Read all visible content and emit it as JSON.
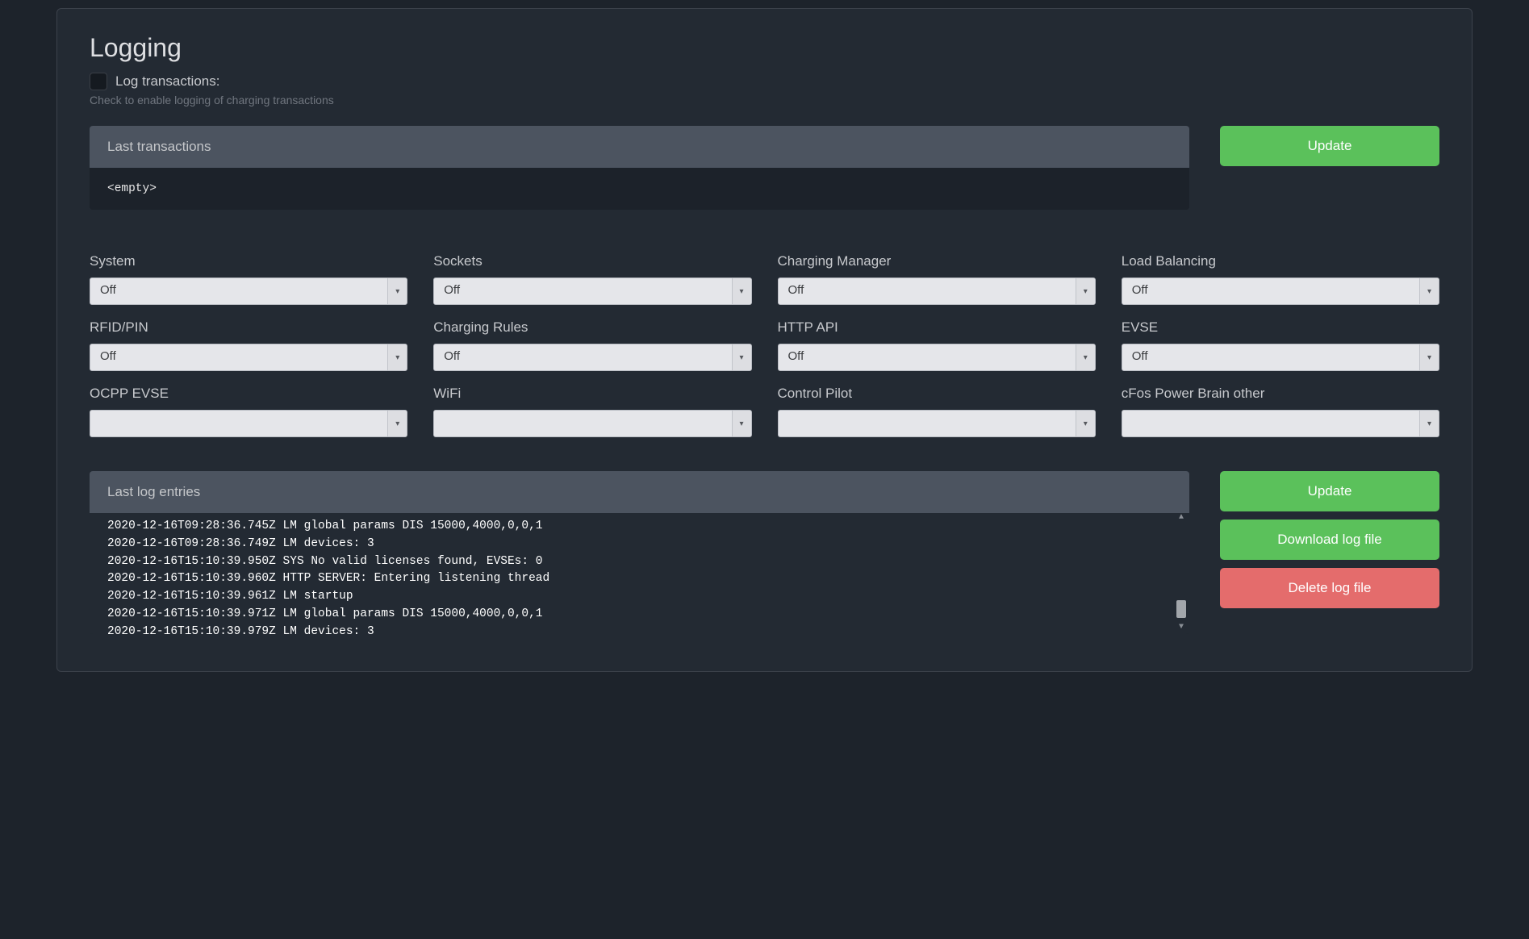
{
  "page_title": "Logging",
  "log_transactions": {
    "label": "Log transactions:",
    "helper": "Check to enable logging of charging transactions",
    "checked": false
  },
  "last_transactions": {
    "header": "Last transactions",
    "body": "<empty>"
  },
  "buttons": {
    "update_transactions": "Update",
    "update_log": "Update",
    "download_log": "Download log file",
    "delete_log": "Delete log file"
  },
  "fields": [
    {
      "name": "system",
      "label": "System",
      "value": "Off"
    },
    {
      "name": "sockets",
      "label": "Sockets",
      "value": "Off"
    },
    {
      "name": "charging-manager",
      "label": "Charging Manager",
      "value": "Off"
    },
    {
      "name": "load-balancing",
      "label": "Load Balancing",
      "value": "Off"
    },
    {
      "name": "rfid-pin",
      "label": "RFID/PIN",
      "value": "Off"
    },
    {
      "name": "charging-rules",
      "label": "Charging Rules",
      "value": "Off"
    },
    {
      "name": "http-api",
      "label": "HTTP API",
      "value": "Off"
    },
    {
      "name": "evse",
      "label": "EVSE",
      "value": "Off"
    },
    {
      "name": "ocpp-evse",
      "label": "OCPP EVSE",
      "value": ""
    },
    {
      "name": "wifi",
      "label": "WiFi",
      "value": ""
    },
    {
      "name": "control-pilot",
      "label": "Control Pilot",
      "value": ""
    },
    {
      "name": "cfos-other",
      "label": "cFos Power Brain other",
      "value": ""
    }
  ],
  "last_log": {
    "header": "Last log entries",
    "lines": [
      "2020-12-16T09:28:36.745Z LM global params DIS 15000,4000,0,0,1",
      "2020-12-16T09:28:36.749Z LM devices: 3",
      "2020-12-16T15:10:39.950Z SYS No valid licenses found, EVSEs: 0",
      "2020-12-16T15:10:39.960Z HTTP SERVER: Entering listening thread",
      "2020-12-16T15:10:39.961Z LM startup",
      "2020-12-16T15:10:39.971Z LM global params DIS 15000,4000,0,0,1",
      "2020-12-16T15:10:39.979Z LM devices: 3"
    ]
  }
}
